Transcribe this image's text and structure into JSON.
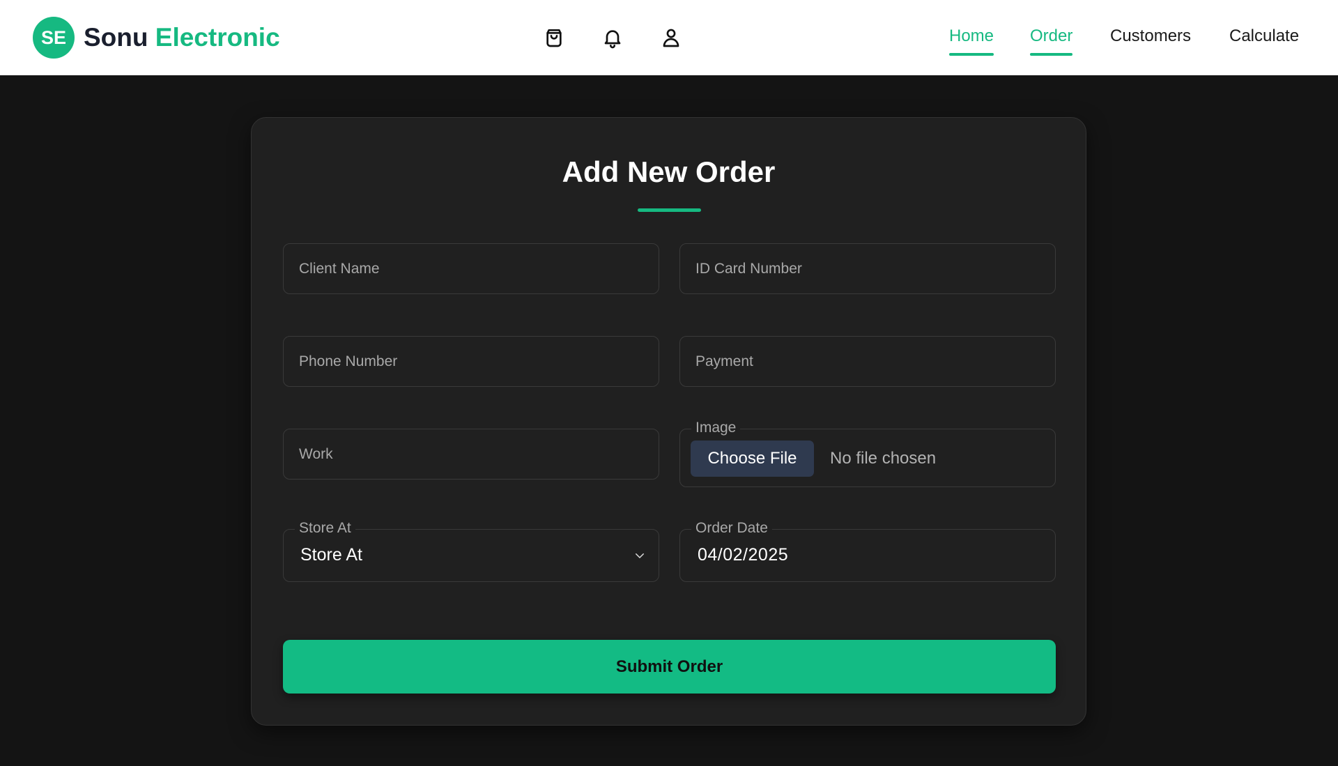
{
  "brand": {
    "logo_text": "SE",
    "name_primary": "Sonu",
    "name_accent": "Electronic",
    "accent_color": "#16b981"
  },
  "header_icons": [
    "shopping-bag-icon",
    "bell-icon",
    "user-icon"
  ],
  "nav": {
    "home": "Home",
    "order": "Order",
    "customers": "Customers",
    "calculate": "Calculate"
  },
  "form": {
    "title": "Add New Order",
    "client_name_placeholder": "Client Name",
    "id_card_placeholder": "ID Card Number",
    "phone_placeholder": "Phone Number",
    "payment_placeholder": "Payment",
    "work_placeholder": "Work",
    "image": {
      "label": "Image",
      "button_label": "Choose File",
      "status": "No file chosen"
    },
    "store_at": {
      "label": "Store At",
      "selected": "Store At"
    },
    "order_date": {
      "label": "Order Date",
      "value": "04/02/2025"
    },
    "submit_label": "Submit Order"
  },
  "colors": {
    "accent": "#16b981",
    "page_bg": "#141414",
    "card_bg": "#202020",
    "button_bg": "#13bb84"
  }
}
